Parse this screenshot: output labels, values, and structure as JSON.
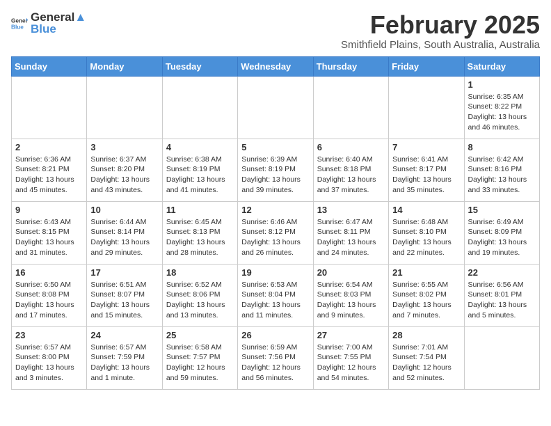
{
  "header": {
    "logo_general": "General",
    "logo_blue": "Blue",
    "month_title": "February 2025",
    "location": "Smithfield Plains, South Australia, Australia"
  },
  "days_of_week": [
    "Sunday",
    "Monday",
    "Tuesday",
    "Wednesday",
    "Thursday",
    "Friday",
    "Saturday"
  ],
  "weeks": [
    [
      {
        "day": "",
        "info": ""
      },
      {
        "day": "",
        "info": ""
      },
      {
        "day": "",
        "info": ""
      },
      {
        "day": "",
        "info": ""
      },
      {
        "day": "",
        "info": ""
      },
      {
        "day": "",
        "info": ""
      },
      {
        "day": "1",
        "info": "Sunrise: 6:35 AM\nSunset: 8:22 PM\nDaylight: 13 hours\nand 46 minutes."
      }
    ],
    [
      {
        "day": "2",
        "info": "Sunrise: 6:36 AM\nSunset: 8:21 PM\nDaylight: 13 hours\nand 45 minutes."
      },
      {
        "day": "3",
        "info": "Sunrise: 6:37 AM\nSunset: 8:20 PM\nDaylight: 13 hours\nand 43 minutes."
      },
      {
        "day": "4",
        "info": "Sunrise: 6:38 AM\nSunset: 8:19 PM\nDaylight: 13 hours\nand 41 minutes."
      },
      {
        "day": "5",
        "info": "Sunrise: 6:39 AM\nSunset: 8:19 PM\nDaylight: 13 hours\nand 39 minutes."
      },
      {
        "day": "6",
        "info": "Sunrise: 6:40 AM\nSunset: 8:18 PM\nDaylight: 13 hours\nand 37 minutes."
      },
      {
        "day": "7",
        "info": "Sunrise: 6:41 AM\nSunset: 8:17 PM\nDaylight: 13 hours\nand 35 minutes."
      },
      {
        "day": "8",
        "info": "Sunrise: 6:42 AM\nSunset: 8:16 PM\nDaylight: 13 hours\nand 33 minutes."
      }
    ],
    [
      {
        "day": "9",
        "info": "Sunrise: 6:43 AM\nSunset: 8:15 PM\nDaylight: 13 hours\nand 31 minutes."
      },
      {
        "day": "10",
        "info": "Sunrise: 6:44 AM\nSunset: 8:14 PM\nDaylight: 13 hours\nand 29 minutes."
      },
      {
        "day": "11",
        "info": "Sunrise: 6:45 AM\nSunset: 8:13 PM\nDaylight: 13 hours\nand 28 minutes."
      },
      {
        "day": "12",
        "info": "Sunrise: 6:46 AM\nSunset: 8:12 PM\nDaylight: 13 hours\nand 26 minutes."
      },
      {
        "day": "13",
        "info": "Sunrise: 6:47 AM\nSunset: 8:11 PM\nDaylight: 13 hours\nand 24 minutes."
      },
      {
        "day": "14",
        "info": "Sunrise: 6:48 AM\nSunset: 8:10 PM\nDaylight: 13 hours\nand 22 minutes."
      },
      {
        "day": "15",
        "info": "Sunrise: 6:49 AM\nSunset: 8:09 PM\nDaylight: 13 hours\nand 19 minutes."
      }
    ],
    [
      {
        "day": "16",
        "info": "Sunrise: 6:50 AM\nSunset: 8:08 PM\nDaylight: 13 hours\nand 17 minutes."
      },
      {
        "day": "17",
        "info": "Sunrise: 6:51 AM\nSunset: 8:07 PM\nDaylight: 13 hours\nand 15 minutes."
      },
      {
        "day": "18",
        "info": "Sunrise: 6:52 AM\nSunset: 8:06 PM\nDaylight: 13 hours\nand 13 minutes."
      },
      {
        "day": "19",
        "info": "Sunrise: 6:53 AM\nSunset: 8:04 PM\nDaylight: 13 hours\nand 11 minutes."
      },
      {
        "day": "20",
        "info": "Sunrise: 6:54 AM\nSunset: 8:03 PM\nDaylight: 13 hours\nand 9 minutes."
      },
      {
        "day": "21",
        "info": "Sunrise: 6:55 AM\nSunset: 8:02 PM\nDaylight: 13 hours\nand 7 minutes."
      },
      {
        "day": "22",
        "info": "Sunrise: 6:56 AM\nSunset: 8:01 PM\nDaylight: 13 hours\nand 5 minutes."
      }
    ],
    [
      {
        "day": "23",
        "info": "Sunrise: 6:57 AM\nSunset: 8:00 PM\nDaylight: 13 hours\nand 3 minutes."
      },
      {
        "day": "24",
        "info": "Sunrise: 6:57 AM\nSunset: 7:59 PM\nDaylight: 13 hours\nand 1 minute."
      },
      {
        "day": "25",
        "info": "Sunrise: 6:58 AM\nSunset: 7:57 PM\nDaylight: 12 hours\nand 59 minutes."
      },
      {
        "day": "26",
        "info": "Sunrise: 6:59 AM\nSunset: 7:56 PM\nDaylight: 12 hours\nand 56 minutes."
      },
      {
        "day": "27",
        "info": "Sunrise: 7:00 AM\nSunset: 7:55 PM\nDaylight: 12 hours\nand 54 minutes."
      },
      {
        "day": "28",
        "info": "Sunrise: 7:01 AM\nSunset: 7:54 PM\nDaylight: 12 hours\nand 52 minutes."
      },
      {
        "day": "",
        "info": ""
      }
    ]
  ]
}
